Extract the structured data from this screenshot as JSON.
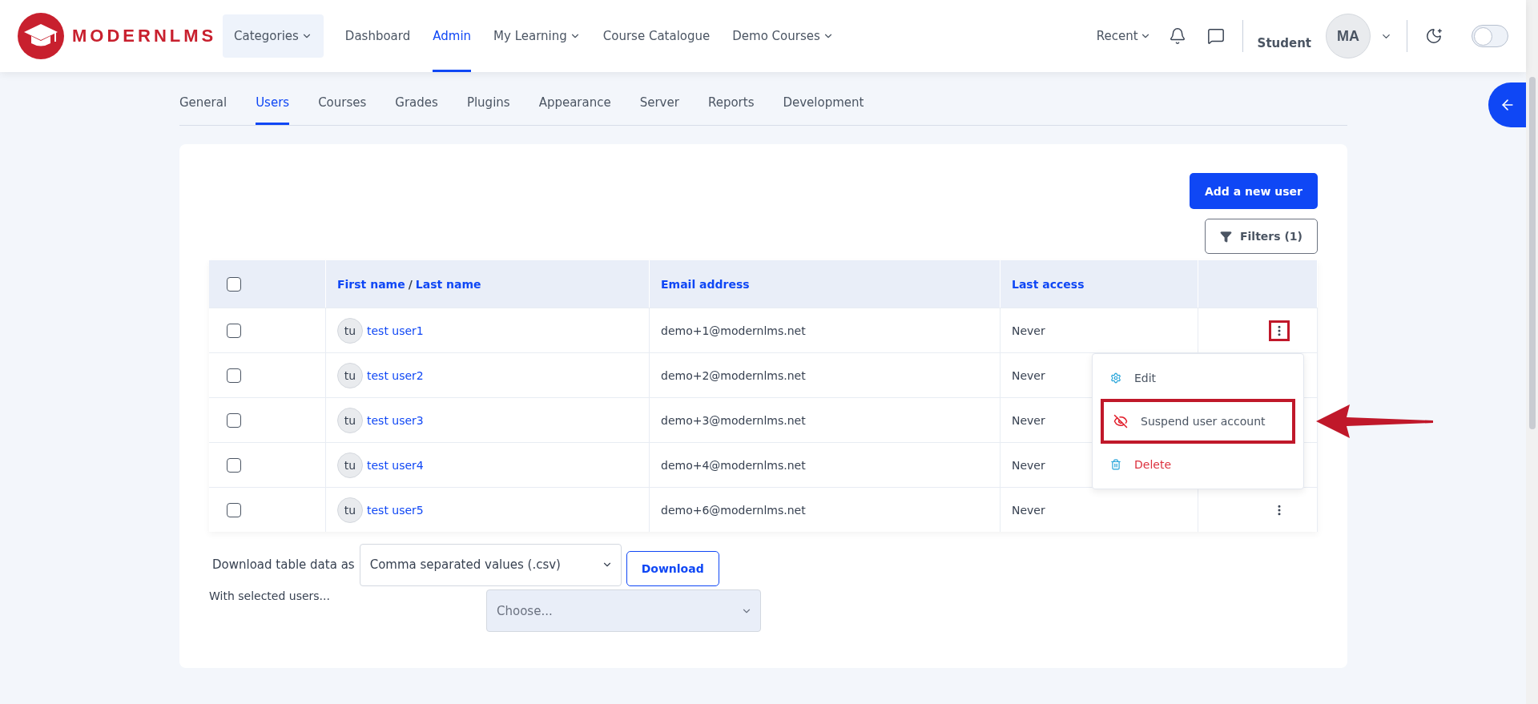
{
  "header": {
    "logo_text": "MODERNLMS",
    "nav": [
      {
        "label": "Categories",
        "dropdown": true,
        "selected": false,
        "boxed": true
      },
      {
        "label": "Dashboard",
        "dropdown": false,
        "selected": false,
        "boxed": false
      },
      {
        "label": "Admin",
        "dropdown": false,
        "selected": true,
        "boxed": false
      },
      {
        "label": "My Learning",
        "dropdown": true,
        "selected": false,
        "boxed": false
      },
      {
        "label": "Course Catalogue",
        "dropdown": false,
        "selected": false,
        "boxed": false
      },
      {
        "label": "Demo Courses",
        "dropdown": true,
        "selected": false,
        "boxed": false
      }
    ],
    "recent": "Recent",
    "user_name": "Student",
    "avatar_initials": "MA",
    "dark_mode": false
  },
  "tabs": [
    {
      "label": "General",
      "selected": false
    },
    {
      "label": "Users",
      "selected": true
    },
    {
      "label": "Courses",
      "selected": false
    },
    {
      "label": "Grades",
      "selected": false
    },
    {
      "label": "Plugins",
      "selected": false
    },
    {
      "label": "Appearance",
      "selected": false
    },
    {
      "label": "Server",
      "selected": false
    },
    {
      "label": "Reports",
      "selected": false
    },
    {
      "label": "Development",
      "selected": false
    }
  ],
  "add_user_button": "Add a new user",
  "filters_button": "Filters (1)",
  "table": {
    "select_all_checked": false,
    "columns": [
      {
        "kind": "name",
        "first": "First name",
        "separator": "/",
        "second": "Last name"
      },
      {
        "kind": "text",
        "label": "Email address"
      },
      {
        "kind": "text",
        "label": "Last access"
      }
    ],
    "rows": [
      {
        "checked": false,
        "initials": "tu",
        "name": "test user1",
        "email": "demo+1@modernlms.net",
        "last_access": "Never",
        "menu_open": true
      },
      {
        "checked": false,
        "initials": "tu",
        "name": "test user2",
        "email": "demo+2@modernlms.net",
        "last_access": "Never",
        "menu_open": false
      },
      {
        "checked": false,
        "initials": "tu",
        "name": "test user3",
        "email": "demo+3@modernlms.net",
        "last_access": "Never",
        "menu_open": false
      },
      {
        "checked": false,
        "initials": "tu",
        "name": "test user4",
        "email": "demo+4@modernlms.net",
        "last_access": "Never",
        "menu_open": false
      },
      {
        "checked": false,
        "initials": "tu",
        "name": "test user5",
        "email": "demo+6@modernlms.net",
        "last_access": "Never",
        "menu_open": false
      }
    ]
  },
  "action_menu": [
    {
      "kind": "edit",
      "label": "Edit",
      "highlighted": false
    },
    {
      "kind": "suspend",
      "label": "Suspend user account",
      "highlighted": true
    },
    {
      "kind": "delete",
      "label": "Delete",
      "highlighted": false
    }
  ],
  "export": {
    "label": "Download table data as",
    "format": "Comma separated values (.csv)",
    "button": "Download"
  },
  "bulk": {
    "label": "With selected users...",
    "value": "Choose..."
  }
}
